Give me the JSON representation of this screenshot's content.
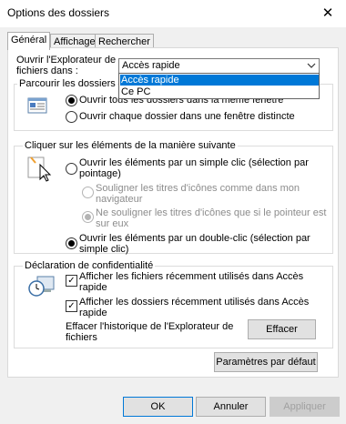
{
  "window": {
    "title": "Options des dossiers",
    "close_glyph": "✕"
  },
  "tabs": [
    {
      "label": "Général"
    },
    {
      "label": "Affichage"
    },
    {
      "label": "Rechercher"
    }
  ],
  "open_explorer": {
    "label_line1": "Ouvrir l'Explorateur de",
    "label_line2": "fichiers dans :",
    "selected": "Accès rapide",
    "options": [
      "Accès rapide",
      "Ce PC"
    ]
  },
  "browse": {
    "title": "Parcourir les dossiers",
    "option1": "Ouvrir tous les dossiers dans la même fenêtre",
    "option2": "Ouvrir chaque dossier dans une fenêtre distincte"
  },
  "click": {
    "title": "Cliquer sur les éléments de la manière suivante",
    "single_line1": "Ouvrir les éléments par un simple clic (sélection par",
    "single_line2": "pointage)",
    "underline_all_line1": "Souligner les titres d'icônes comme dans mon",
    "underline_all_line2": "navigateur",
    "underline_point_line1": "Ne souligner les titres d'icônes que si le pointeur est",
    "underline_point_line2": "sur eux",
    "double_line1": "Ouvrir les éléments par un double-clic (sélection par",
    "double_line2": "simple clic)"
  },
  "privacy": {
    "title": "Déclaration de confidentialité",
    "recent_files_line1": "Afficher les fichiers récemment utilisés dans Accès",
    "recent_files_line2": "rapide",
    "recent_folders_line1": "Afficher les dossiers récemment utilisés dans Accès",
    "recent_folders_line2": "rapide",
    "clear_line1": "Effacer l'historique de l'Explorateur de",
    "clear_line2": "fichiers",
    "clear_button": "Effacer"
  },
  "restore_button": "Paramètres par défaut",
  "footer": {
    "ok": "OK",
    "cancel": "Annuler",
    "apply": "Appliquer"
  }
}
